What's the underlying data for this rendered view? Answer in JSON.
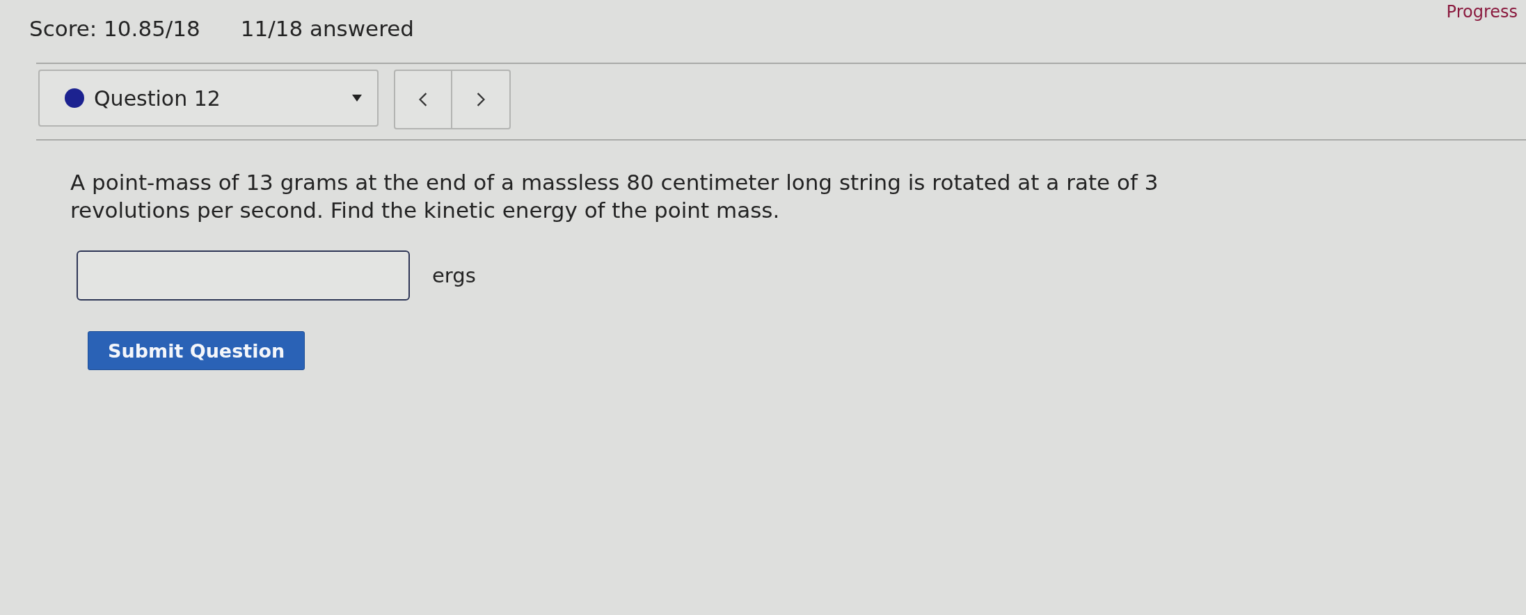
{
  "header": {
    "score": "Score: 10.85/18",
    "answered": "11/18 answered",
    "progress": "Progress"
  },
  "question_nav": {
    "selector": {
      "label": "Question 12"
    }
  },
  "question": {
    "text": "A point-mass of 13 grams at the end of a massless 80 centimeter long string is rotated at a rate of 3 revolutions per second. Find the kinetic energy of the point mass.",
    "answer": {
      "unit": "ergs"
    }
  },
  "submit_button": {
    "label": "Submit Question"
  }
}
